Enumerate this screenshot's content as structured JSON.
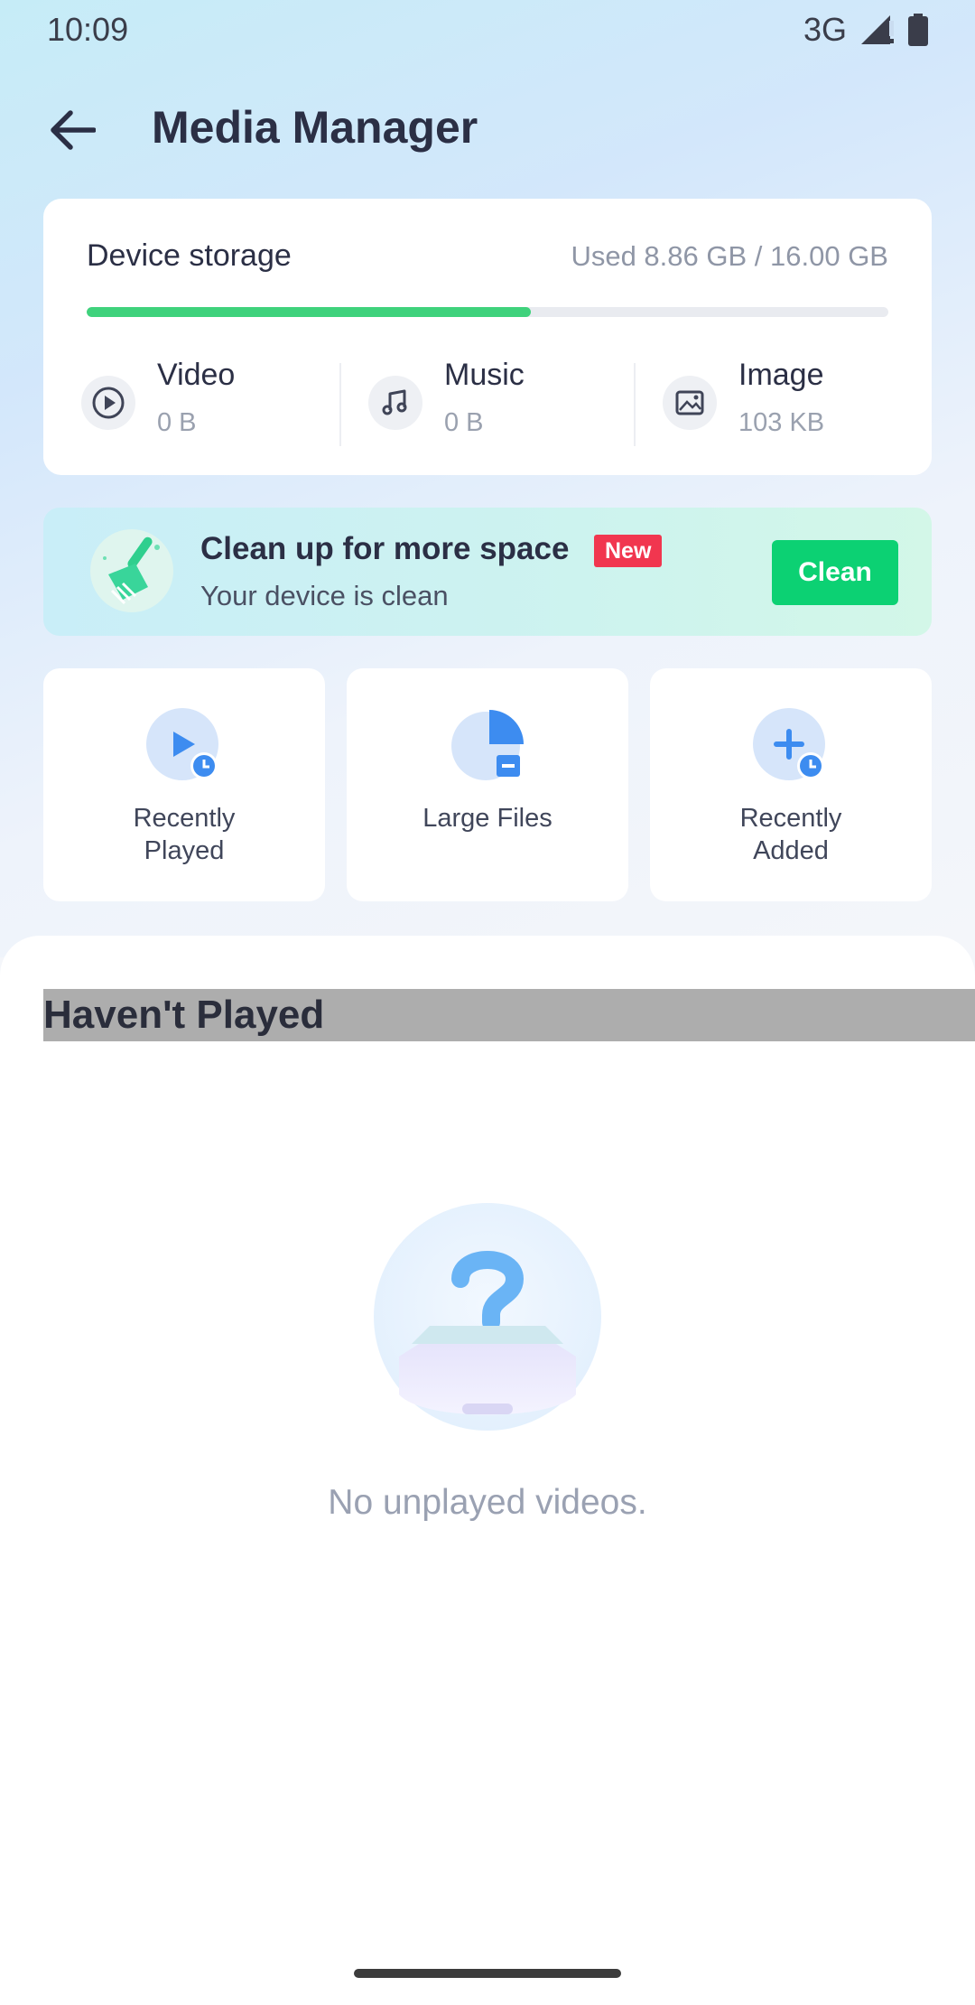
{
  "status_bar": {
    "time": "10:09",
    "network": "3G"
  },
  "app_bar": {
    "title": "Media Manager",
    "back_icon": "arrow-left-icon"
  },
  "storage": {
    "title": "Device storage",
    "used_text": "Used 8.86 GB / 16.00 GB",
    "used_gb": 8.86,
    "total_gb": 16.0,
    "used_fraction": 0.554,
    "bar_color": "#3fd27c",
    "categories": [
      {
        "name": "Video",
        "size": "0 B",
        "icon": "play-circle-icon"
      },
      {
        "name": "Music",
        "size": "0 B",
        "icon": "music-note-icon"
      },
      {
        "name": "Image",
        "size": "103 KB",
        "icon": "image-icon"
      }
    ]
  },
  "clean_banner": {
    "title": "Clean up for more space",
    "badge": "New",
    "subtitle": "Your device is clean",
    "button_label": "Clean",
    "icon": "broom-icon",
    "button_color": "#0cd173",
    "badge_color": "#f1364f"
  },
  "tiles": [
    {
      "label": "Recently Played",
      "icon": "recently-played-icon"
    },
    {
      "label": "Large Files",
      "icon": "large-files-icon"
    },
    {
      "label": "Recently Added",
      "icon": "recently-added-icon"
    }
  ],
  "section": {
    "title": "Haven't Played",
    "empty_message": "No unplayed videos.",
    "empty_icon": "question-box-icon"
  }
}
